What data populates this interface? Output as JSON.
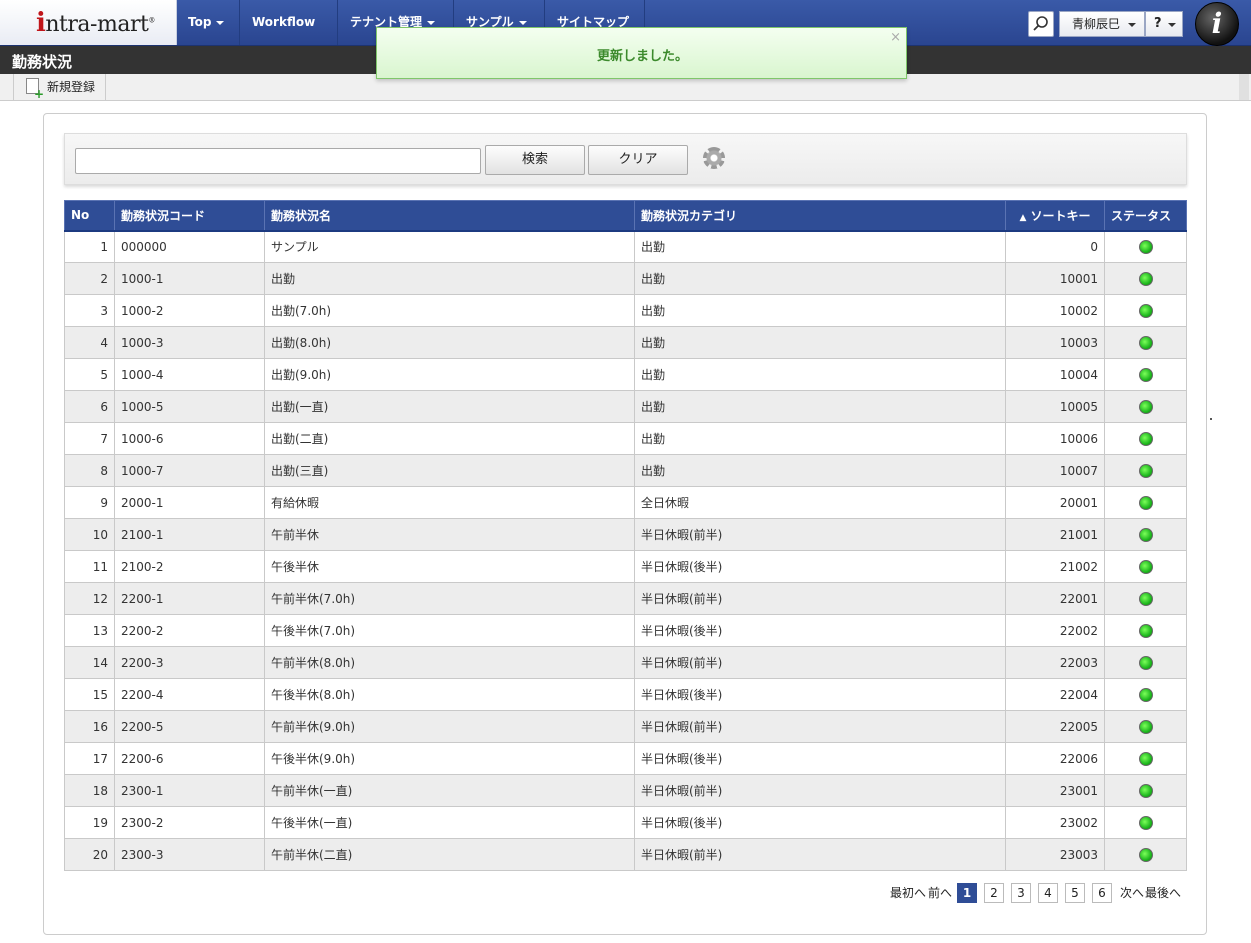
{
  "header": {
    "logo_text": "intra-mart",
    "nav": [
      {
        "label": "Top"
      },
      {
        "label": "Workflow"
      },
      {
        "label": "テナント管理"
      },
      {
        "label": "サンプル"
      },
      {
        "label": "サイトマップ"
      }
    ],
    "user_name": "青柳辰巳",
    "help_label": "?",
    "brand_letter": "i"
  },
  "notification": {
    "message": "更新しました。",
    "close": "×"
  },
  "page": {
    "title": "勤務状況"
  },
  "toolbar": {
    "new_label": "新規登録"
  },
  "search": {
    "value": "",
    "search_label": "検索",
    "clear_label": "クリア"
  },
  "table": {
    "columns": [
      "No",
      "勤務状況コード",
      "勤務状況名",
      "勤務状況カテゴリ",
      "ソートキー",
      "ステータス"
    ],
    "sort_indicator": "▲",
    "rows": [
      {
        "no": "1",
        "code": "000000",
        "name": "サンプル",
        "category": "出勤",
        "sort": "0"
      },
      {
        "no": "2",
        "code": "1000-1",
        "name": "出勤",
        "category": "出勤",
        "sort": "10001"
      },
      {
        "no": "3",
        "code": "1000-2",
        "name": "出勤(7.0h)",
        "category": "出勤",
        "sort": "10002"
      },
      {
        "no": "4",
        "code": "1000-3",
        "name": "出勤(8.0h)",
        "category": "出勤",
        "sort": "10003"
      },
      {
        "no": "5",
        "code": "1000-4",
        "name": "出勤(9.0h)",
        "category": "出勤",
        "sort": "10004"
      },
      {
        "no": "6",
        "code": "1000-5",
        "name": "出勤(一直)",
        "category": "出勤",
        "sort": "10005"
      },
      {
        "no": "7",
        "code": "1000-6",
        "name": "出勤(二直)",
        "category": "出勤",
        "sort": "10006"
      },
      {
        "no": "8",
        "code": "1000-7",
        "name": "出勤(三直)",
        "category": "出勤",
        "sort": "10007"
      },
      {
        "no": "9",
        "code": "2000-1",
        "name": "有給休暇",
        "category": "全日休暇",
        "sort": "20001"
      },
      {
        "no": "10",
        "code": "2100-1",
        "name": "午前半休",
        "category": "半日休暇(前半)",
        "sort": "21001"
      },
      {
        "no": "11",
        "code": "2100-2",
        "name": "午後半休",
        "category": "半日休暇(後半)",
        "sort": "21002"
      },
      {
        "no": "12",
        "code": "2200-1",
        "name": "午前半休(7.0h)",
        "category": "半日休暇(前半)",
        "sort": "22001"
      },
      {
        "no": "13",
        "code": "2200-2",
        "name": "午後半休(7.0h)",
        "category": "半日休暇(後半)",
        "sort": "22002"
      },
      {
        "no": "14",
        "code": "2200-3",
        "name": "午前半休(8.0h)",
        "category": "半日休暇(前半)",
        "sort": "22003"
      },
      {
        "no": "15",
        "code": "2200-4",
        "name": "午後半休(8.0h)",
        "category": "半日休暇(後半)",
        "sort": "22004"
      },
      {
        "no": "16",
        "code": "2200-5",
        "name": "午前半休(9.0h)",
        "category": "半日休暇(前半)",
        "sort": "22005"
      },
      {
        "no": "17",
        "code": "2200-6",
        "name": "午後半休(9.0h)",
        "category": "半日休暇(後半)",
        "sort": "22006"
      },
      {
        "no": "18",
        "code": "2300-1",
        "name": "午前半休(一直)",
        "category": "半日休暇(前半)",
        "sort": "23001"
      },
      {
        "no": "19",
        "code": "2300-2",
        "name": "午後半休(一直)",
        "category": "半日休暇(後半)",
        "sort": "23002"
      },
      {
        "no": "20",
        "code": "2300-3",
        "name": "午前半休(二直)",
        "category": "半日休暇(前半)",
        "sort": "23003"
      }
    ]
  },
  "pager": {
    "first": "最初へ",
    "prev": "前へ",
    "pages": [
      "1",
      "2",
      "3",
      "4",
      "5",
      "6"
    ],
    "current": "1",
    "next": "次へ",
    "last": "最後へ"
  },
  "colors": {
    "header": "#2f4d96",
    "status_active": "#1fb81f"
  },
  "icons": {
    "search": "search-icon",
    "settings": "gear-icon",
    "new": "add-document-icon"
  }
}
